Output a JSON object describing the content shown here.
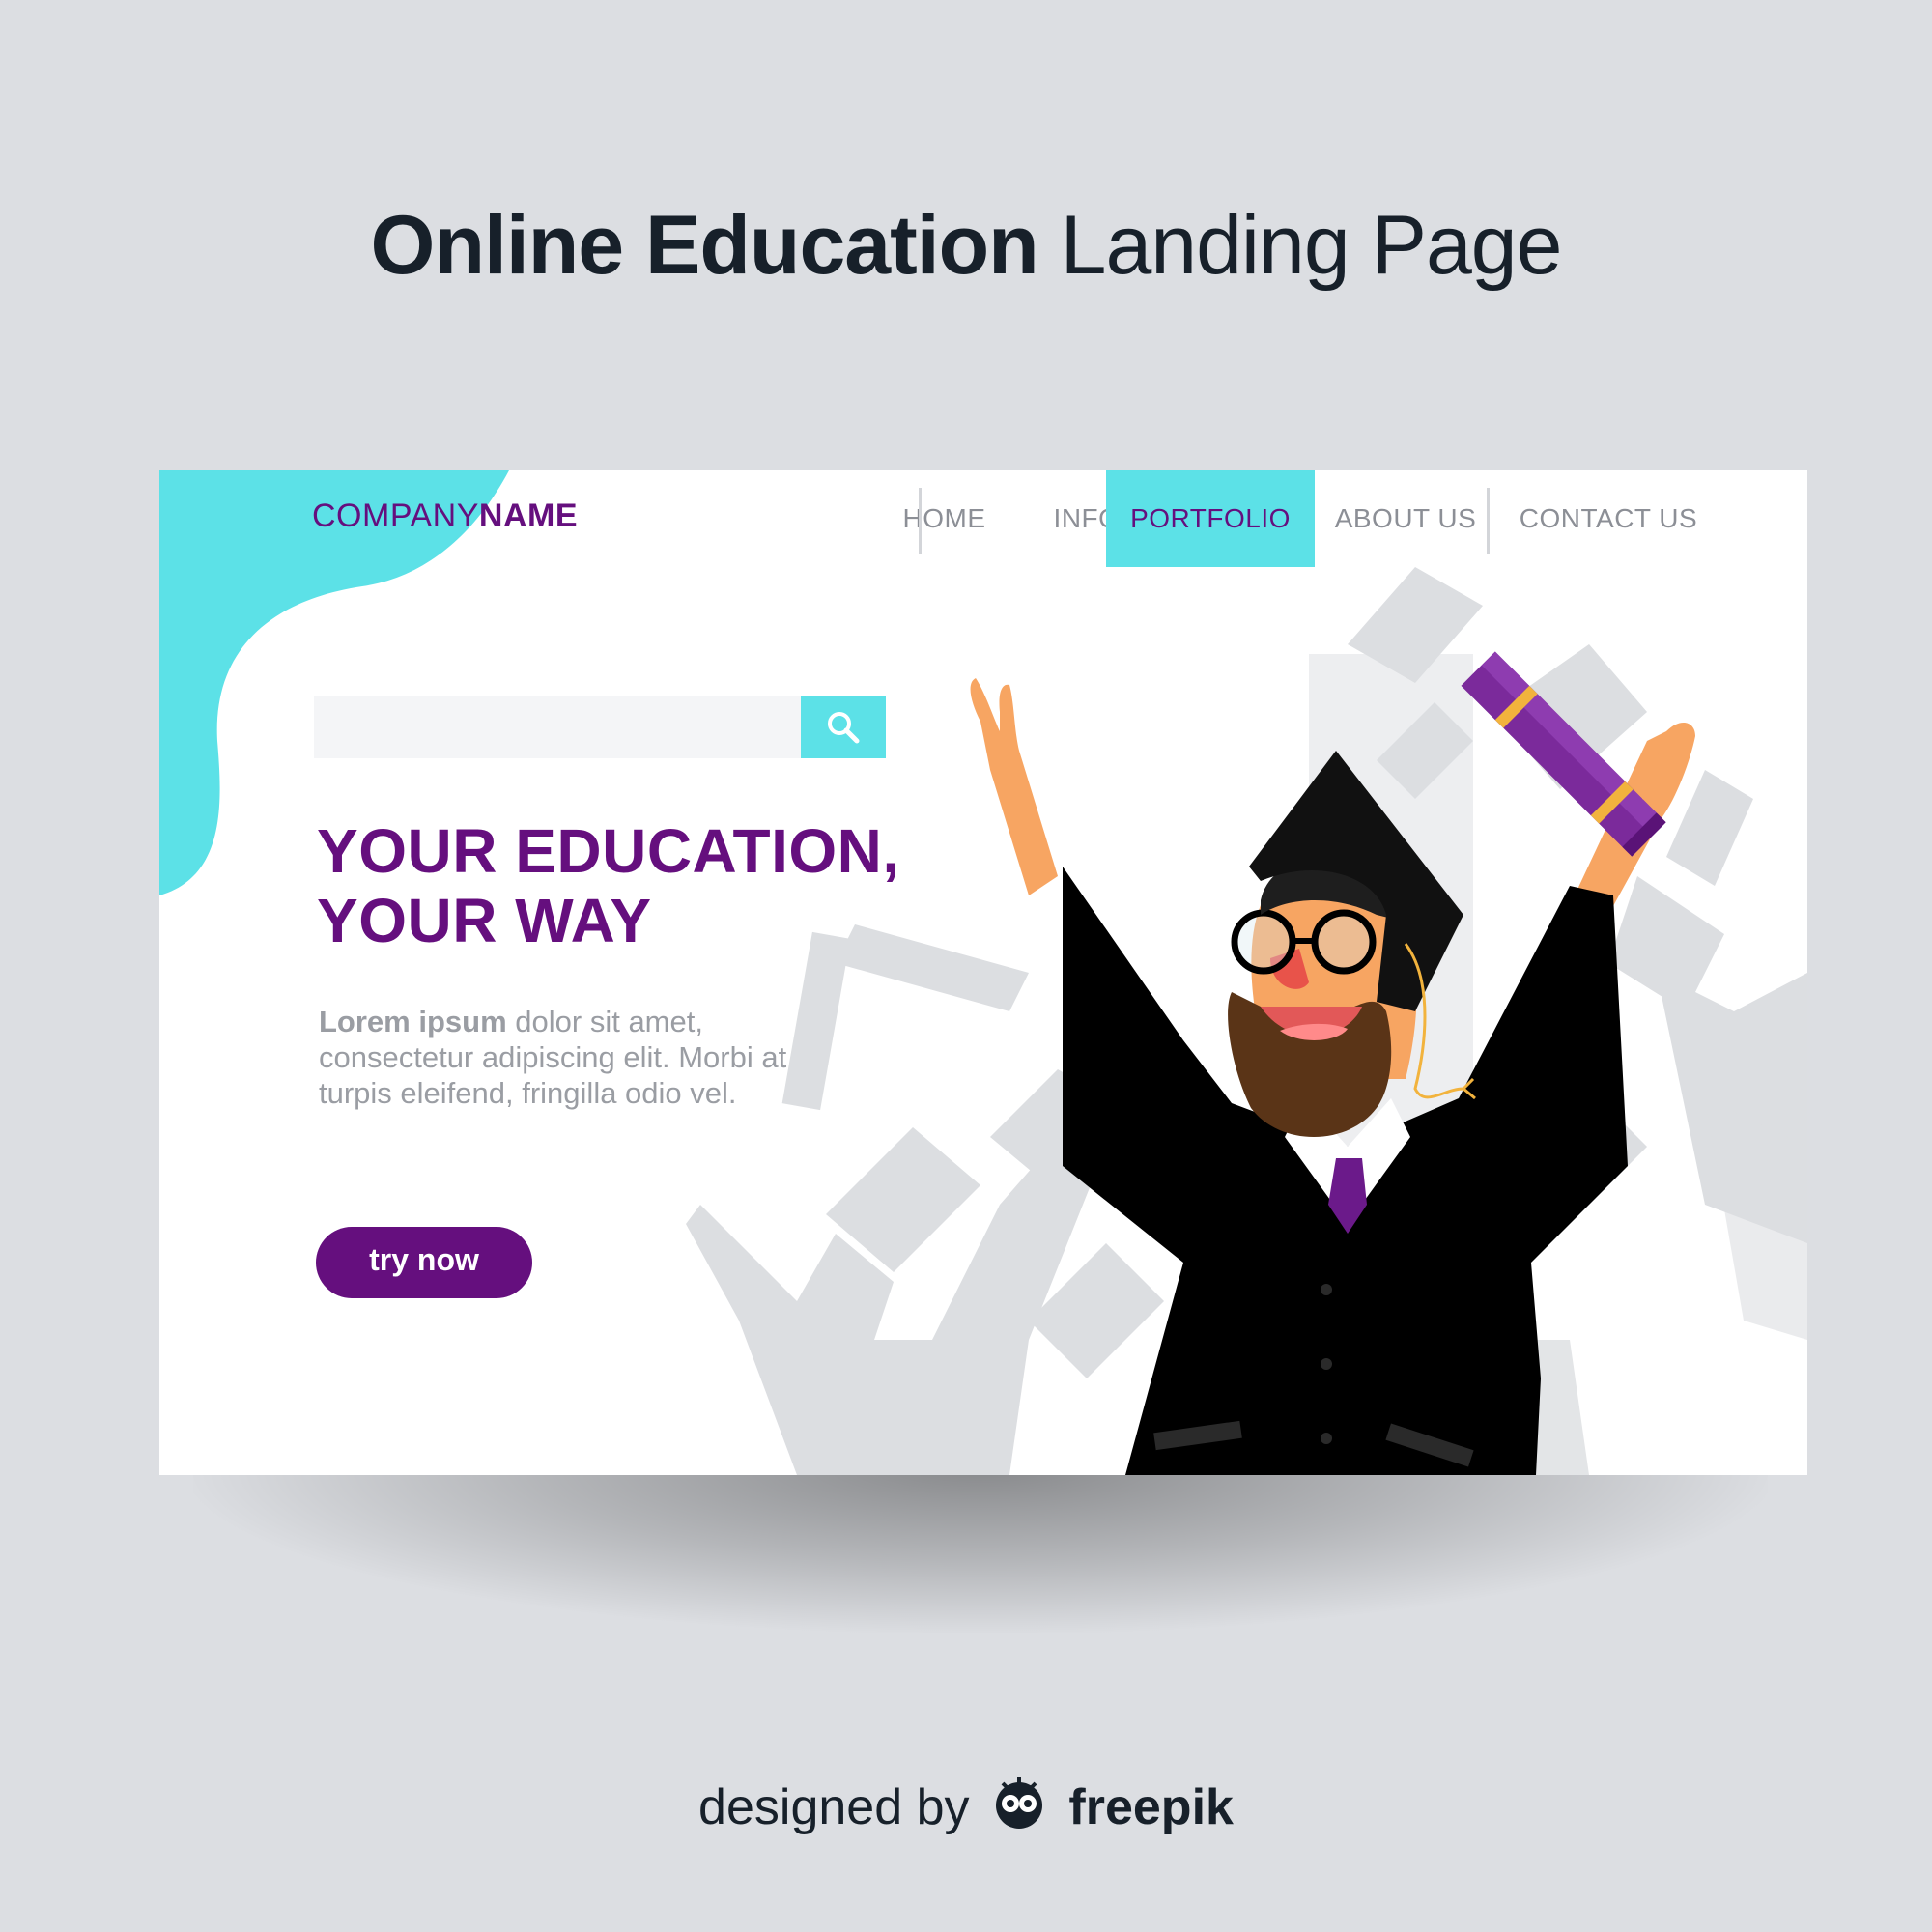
{
  "page_title": {
    "bold_part": "Online Education",
    "light_part": "Landing Page"
  },
  "card": {
    "logo": {
      "light": "COMPANY",
      "bold": "NAME"
    },
    "nav": {
      "items": [
        {
          "label": "HOME",
          "active": false
        },
        {
          "label": "INFO",
          "active": false
        },
        {
          "label": "PORTFOLIO",
          "active": true
        },
        {
          "label": "ABOUT US",
          "active": false
        },
        {
          "label": "CONTACT US",
          "active": false
        }
      ]
    },
    "search": {
      "value": "",
      "icon": "search-icon"
    },
    "headline": {
      "line1": "YOUR EDUCATION,",
      "line2": "YOUR WAY"
    },
    "body": {
      "lead": "Lorem ipsum",
      "text": "dolor sit amet, consectetur adipiscing elit. Morbi at turpis eleifend, fringilla odio vel."
    },
    "cta_label": "try now"
  },
  "credit": {
    "prefix": "designed by",
    "brand": "freepik",
    "icon": "freepik-owl-icon"
  },
  "colors": {
    "background": "#dcdee2",
    "accent_cyan": "#5ce1e7",
    "brand_purple": "#650f7e",
    "text_gray": "#8c8f96",
    "title_dark": "#17202a"
  }
}
